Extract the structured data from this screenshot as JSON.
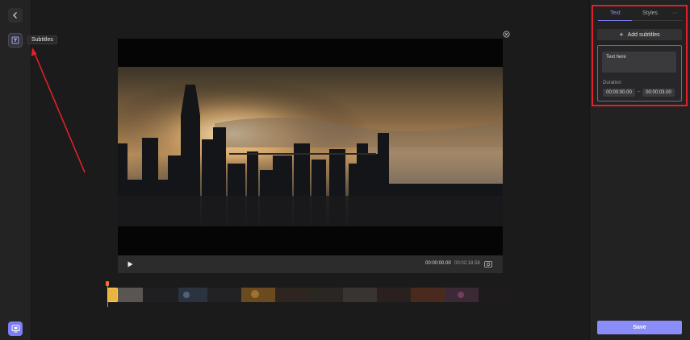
{
  "left_rail": {
    "tooltip": "Subtitles",
    "icons": [
      "back-arrow-icon",
      "subtitles-icon",
      "preview-icon"
    ]
  },
  "player": {
    "current_time": "00:00:00.00",
    "separator": "/",
    "total_time": "00:02:18.58"
  },
  "right_panel": {
    "tabs": [
      {
        "label": "Text",
        "active": true
      },
      {
        "label": "Styles",
        "active": false
      },
      {
        "label": "···",
        "active": false
      }
    ],
    "add_button_label": "Add subtitles",
    "subtitle_card": {
      "text_value": "Text here",
      "duration_label": "Duration",
      "start_time": "00:00:00.00",
      "range_separator": "–",
      "end_time": "00:00:03.00"
    },
    "save_label": "Save"
  },
  "colors": {
    "accent": "#7b7ef5",
    "highlight": "#e0202a",
    "playhead": "#ff6a3d"
  }
}
